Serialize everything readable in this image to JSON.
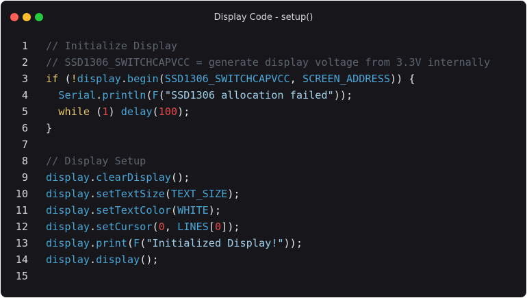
{
  "window": {
    "title": "Display Code - setup()",
    "controls": [
      {
        "name": "close",
        "color": "#ff5f56"
      },
      {
        "name": "minimize",
        "color": "#ffbd2e"
      },
      {
        "name": "maximize",
        "color": "#27c93f"
      }
    ]
  },
  "colors": {
    "background": "#17171b",
    "comment": "#5c6570",
    "keyword": "#e8c56b",
    "identifier": "#49a6d6",
    "string": "#9fd0ea",
    "number": "#e34a4a",
    "punctuation": "#e4e4e4",
    "linenumber": "#d8d8d8"
  },
  "code": {
    "lines": [
      {
        "n": "1",
        "tokens": [
          {
            "t": "// Initialize Display",
            "c": "comment"
          }
        ]
      },
      {
        "n": "2",
        "tokens": [
          {
            "t": "// SSD1306_SWITCHCAPVCC = generate display voltage from 3.3V internally",
            "c": "comment"
          }
        ]
      },
      {
        "n": "3",
        "tokens": [
          {
            "t": "if",
            "c": "keyword"
          },
          {
            "t": " (",
            "c": "punctuation"
          },
          {
            "t": "!",
            "c": "keyword"
          },
          {
            "t": "display",
            "c": "identifier"
          },
          {
            "t": ".",
            "c": "punctuation"
          },
          {
            "t": "begin",
            "c": "identifier"
          },
          {
            "t": "(",
            "c": "punctuation"
          },
          {
            "t": "SSD1306_SWITCHCAPVCC",
            "c": "identifier"
          },
          {
            "t": ", ",
            "c": "punctuation"
          },
          {
            "t": "SCREEN_ADDRESS",
            "c": "identifier"
          },
          {
            "t": ")) {",
            "c": "punctuation"
          }
        ]
      },
      {
        "n": "4",
        "tokens": [
          {
            "t": "  ",
            "c": "punctuation"
          },
          {
            "t": "Serial",
            "c": "identifier"
          },
          {
            "t": ".",
            "c": "punctuation"
          },
          {
            "t": "println",
            "c": "identifier"
          },
          {
            "t": "(",
            "c": "punctuation"
          },
          {
            "t": "F",
            "c": "identifier"
          },
          {
            "t": "(",
            "c": "punctuation"
          },
          {
            "t": "\"SSD1306 allocation failed\"",
            "c": "string"
          },
          {
            "t": "));",
            "c": "punctuation"
          }
        ]
      },
      {
        "n": "5",
        "tokens": [
          {
            "t": "  ",
            "c": "punctuation"
          },
          {
            "t": "while",
            "c": "keyword"
          },
          {
            "t": " (",
            "c": "punctuation"
          },
          {
            "t": "1",
            "c": "number"
          },
          {
            "t": ") ",
            "c": "punctuation"
          },
          {
            "t": "delay",
            "c": "identifier"
          },
          {
            "t": "(",
            "c": "punctuation"
          },
          {
            "t": "100",
            "c": "number"
          },
          {
            "t": ");",
            "c": "punctuation"
          }
        ]
      },
      {
        "n": "6",
        "tokens": [
          {
            "t": "}",
            "c": "punctuation"
          }
        ]
      },
      {
        "n": "7",
        "tokens": []
      },
      {
        "n": "8",
        "tokens": [
          {
            "t": "// Display Setup",
            "c": "comment"
          }
        ]
      },
      {
        "n": "9",
        "tokens": [
          {
            "t": "display",
            "c": "identifier"
          },
          {
            "t": ".",
            "c": "punctuation"
          },
          {
            "t": "clearDisplay",
            "c": "identifier"
          },
          {
            "t": "();",
            "c": "punctuation"
          }
        ]
      },
      {
        "n": "10",
        "tokens": [
          {
            "t": "display",
            "c": "identifier"
          },
          {
            "t": ".",
            "c": "punctuation"
          },
          {
            "t": "setTextSize",
            "c": "identifier"
          },
          {
            "t": "(",
            "c": "punctuation"
          },
          {
            "t": "TEXT_SIZE",
            "c": "identifier"
          },
          {
            "t": ");",
            "c": "punctuation"
          }
        ]
      },
      {
        "n": "11",
        "tokens": [
          {
            "t": "display",
            "c": "identifier"
          },
          {
            "t": ".",
            "c": "punctuation"
          },
          {
            "t": "setTextColor",
            "c": "identifier"
          },
          {
            "t": "(",
            "c": "punctuation"
          },
          {
            "t": "WHITE",
            "c": "identifier"
          },
          {
            "t": ");",
            "c": "punctuation"
          }
        ]
      },
      {
        "n": "12",
        "tokens": [
          {
            "t": "display",
            "c": "identifier"
          },
          {
            "t": ".",
            "c": "punctuation"
          },
          {
            "t": "setCursor",
            "c": "identifier"
          },
          {
            "t": "(",
            "c": "punctuation"
          },
          {
            "t": "0",
            "c": "number"
          },
          {
            "t": ", ",
            "c": "punctuation"
          },
          {
            "t": "LINES",
            "c": "identifier"
          },
          {
            "t": "[",
            "c": "punctuation"
          },
          {
            "t": "0",
            "c": "number"
          },
          {
            "t": "]);",
            "c": "punctuation"
          }
        ]
      },
      {
        "n": "13",
        "tokens": [
          {
            "t": "display",
            "c": "identifier"
          },
          {
            "t": ".",
            "c": "punctuation"
          },
          {
            "t": "print",
            "c": "identifier"
          },
          {
            "t": "(",
            "c": "punctuation"
          },
          {
            "t": "F",
            "c": "identifier"
          },
          {
            "t": "(",
            "c": "punctuation"
          },
          {
            "t": "\"Initialized Display!\"",
            "c": "string"
          },
          {
            "t": "));",
            "c": "punctuation"
          }
        ]
      },
      {
        "n": "14",
        "tokens": [
          {
            "t": "display",
            "c": "identifier"
          },
          {
            "t": ".",
            "c": "punctuation"
          },
          {
            "t": "display",
            "c": "identifier"
          },
          {
            "t": "();",
            "c": "punctuation"
          }
        ]
      },
      {
        "n": "15",
        "tokens": []
      }
    ]
  }
}
